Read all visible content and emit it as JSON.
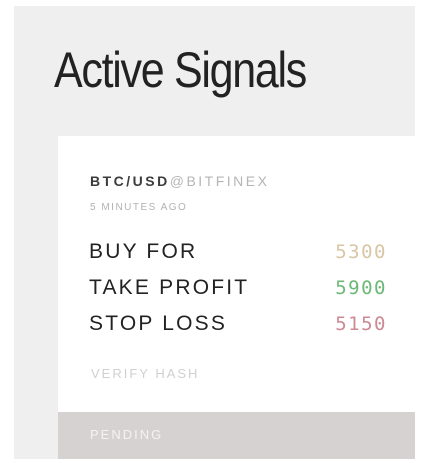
{
  "header": {
    "title": "Active Signals"
  },
  "signal": {
    "pair": "BTC/USD",
    "exchange": "@BITFINEX",
    "time_ago": "5 MINUTES AGO",
    "rows": [
      {
        "label": "BUY FOR",
        "value": "5300",
        "color": "#d8c6a6"
      },
      {
        "label": "TAKE PROFIT",
        "value": "5900",
        "color": "#6cb877"
      },
      {
        "label": "STOP LOSS",
        "value": "5150",
        "color": "#cc8a94"
      }
    ],
    "verify_label": "VERIFY HASH",
    "status": "PENDING"
  },
  "colors": {
    "panel_bg": "#efefef",
    "card_bg": "#ffffff",
    "status_bg": "#d6d2d2",
    "buy": "#d8c6a6",
    "take_profit": "#6cb877",
    "stop_loss": "#cc8a94"
  }
}
